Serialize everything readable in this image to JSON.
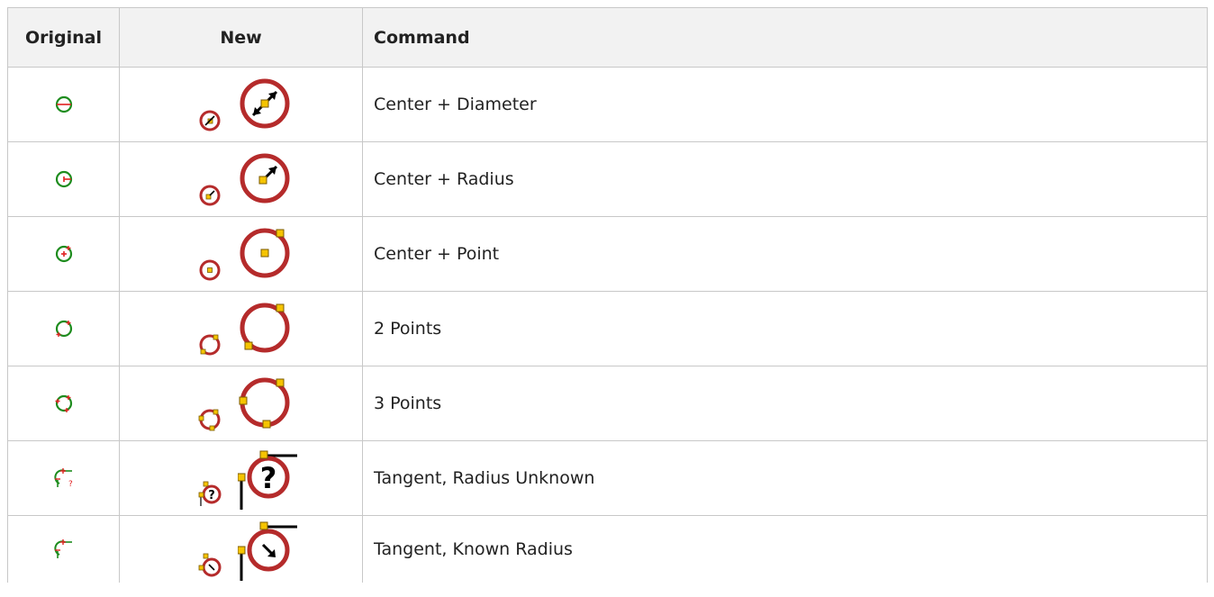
{
  "table": {
    "headers": {
      "original": "Original",
      "new": "New",
      "command": "Command"
    },
    "rows": [
      {
        "command": "Center + Diameter",
        "original_icon": "circle-center-diameter-icon",
        "new_small_icon": "circle-center-diameter-small-icon",
        "new_large_icon": "circle-center-diameter-large-icon"
      },
      {
        "command": "Center + Radius",
        "original_icon": "circle-center-radius-icon",
        "new_small_icon": "circle-center-radius-small-icon",
        "new_large_icon": "circle-center-radius-large-icon"
      },
      {
        "command": "Center + Point",
        "original_icon": "circle-center-point-icon",
        "new_small_icon": "circle-center-point-small-icon",
        "new_large_icon": "circle-center-point-large-icon"
      },
      {
        "command": "2 Points",
        "original_icon": "circle-2-points-icon",
        "new_small_icon": "circle-2-points-small-icon",
        "new_large_icon": "circle-2-points-large-icon"
      },
      {
        "command": "3 Points",
        "original_icon": "circle-3-points-icon",
        "new_small_icon": "circle-3-points-small-icon",
        "new_large_icon": "circle-3-points-large-icon"
      },
      {
        "command": "Tangent, Radius Unknown",
        "original_icon": "circle-tangent-radius-unknown-icon",
        "new_small_icon": "circle-tangent-radius-unknown-small-icon",
        "new_large_icon": "circle-tangent-radius-unknown-large-icon"
      },
      {
        "command": "Tangent, Known Radius",
        "original_icon": "circle-tangent-known-radius-icon",
        "new_small_icon": "circle-tangent-known-radius-small-icon",
        "new_large_icon": "circle-tangent-known-radius-large-icon"
      }
    ]
  },
  "colors": {
    "header_bg": "#f2f2f2",
    "border": "#c8c8c8",
    "new_icon_red": "#b52b2b",
    "original_icon_green": "#1e8c1e",
    "original_icon_red": "#e02020",
    "handle_yellow": "#f5c400"
  }
}
